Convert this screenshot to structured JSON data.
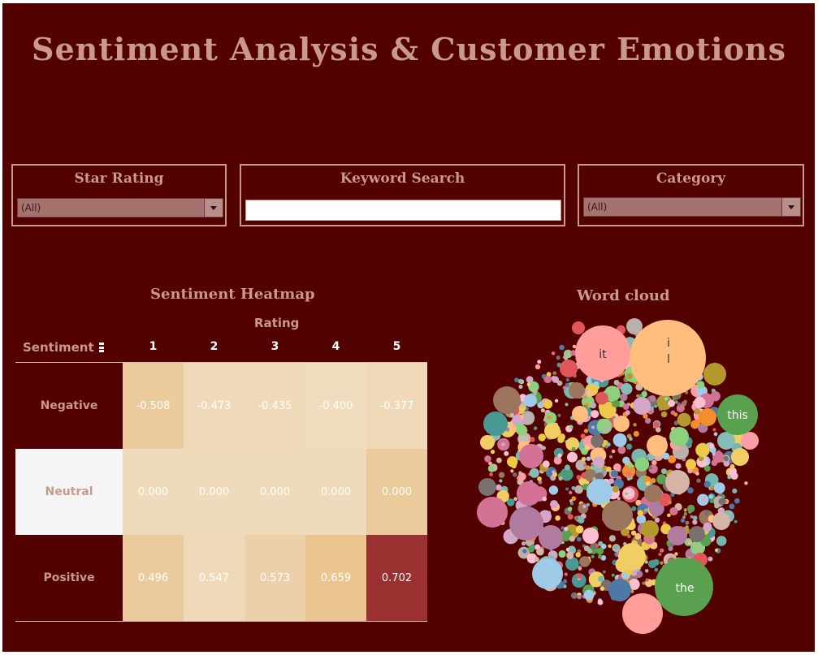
{
  "title": "Sentiment Analysis & Customer Emotions",
  "filters": {
    "star_rating": {
      "label": "Star Rating",
      "value": "(All)"
    },
    "keyword_search": {
      "label": "Keyword Search",
      "value": ""
    },
    "category": {
      "label": "Category",
      "value": "(All)"
    }
  },
  "heatmap": {
    "title": "Sentiment Heatmap",
    "column_group_label": "Rating",
    "row_header": "Sentiment",
    "columns": [
      "1",
      "2",
      "3",
      "4",
      "5"
    ],
    "rows": [
      {
        "label": "Negative",
        "cells": [
          "-0.508",
          "-0.473",
          "-0.435",
          "-0.400",
          "-0.377"
        ],
        "colors": [
          "#ebcb9c",
          "#efd9b9",
          "#efd9b9",
          "#efdbbd",
          "#efd9b9"
        ]
      },
      {
        "label": "Neutral",
        "cells": [
          "0.000",
          "0.000",
          "0.000",
          "0.000",
          "0.000"
        ],
        "colors": [
          "#efdbbb",
          "#efdbbb",
          "#efdbbb",
          "#efdbbb",
          "#ebcb9c"
        ]
      },
      {
        "label": "Positive",
        "cells": [
          "0.496",
          "0.547",
          "0.573",
          "0.659",
          "0.702"
        ],
        "colors": [
          "#ebcb9c",
          "#efd9b9",
          "#ecd0a9",
          "#ebc58f",
          "#9b3030"
        ]
      }
    ]
  },
  "word_cloud": {
    "title": "Word cloud",
    "words": [
      {
        "text": "it",
        "color": "#ff9d9a"
      },
      {
        "text": "i\nl",
        "color": "#ffbe7d"
      },
      {
        "text": "this",
        "color": "#59a14f"
      },
      {
        "text": "the",
        "color": "#59a14f"
      }
    ]
  },
  "colors": {
    "background": "#520000",
    "accent": "#c9998a"
  }
}
